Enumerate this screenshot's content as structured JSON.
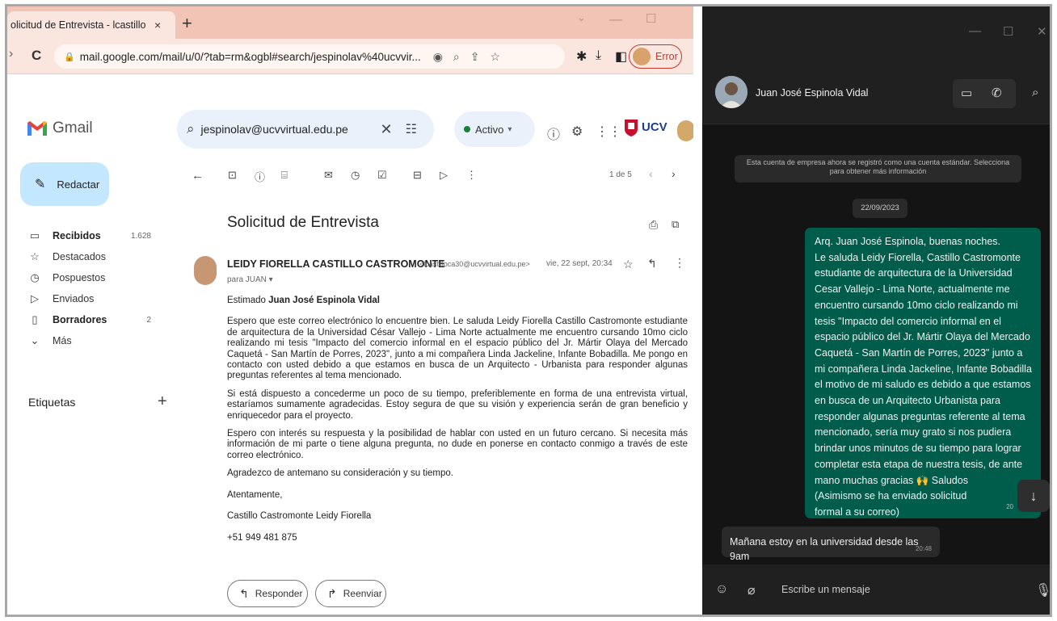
{
  "browser": {
    "tab_title": "olicitud de Entrevista - lcastillo",
    "tab_close": "×",
    "new_tab": "+",
    "url": "mail.google.com/mail/u/0/?tab=rm&ogbl#search/jespinolav%40ucvvir...",
    "profile_status": "Error"
  },
  "gmail": {
    "logo_text": "Gmail",
    "search_value": "jespinolav@ucvvirtual.edu.pe",
    "status_label": "Activo",
    "org_logo_text": "UCV",
    "compose_label": "Redactar",
    "nav": [
      {
        "label": "Recibidos",
        "count": "1.628",
        "bold": true,
        "icon": "inbox-icon"
      },
      {
        "label": "Destacados",
        "count": "",
        "bold": false,
        "icon": "star-icon"
      },
      {
        "label": "Pospuestos",
        "count": "",
        "bold": false,
        "icon": "clock-icon"
      },
      {
        "label": "Enviados",
        "count": "",
        "bold": false,
        "icon": "send-icon"
      },
      {
        "label": "Borradores",
        "count": "2",
        "bold": true,
        "icon": "draft-icon"
      },
      {
        "label": "Más",
        "count": "",
        "bold": false,
        "icon": "chevron-down-icon"
      }
    ],
    "labels_title": "Etiquetas",
    "labels_add": "+",
    "page_count": "1 de 5"
  },
  "email": {
    "subject": "Solicitud de Entrevista",
    "sender_name": "LEIDY FIORELLA CASTILLO CASTROMONTE",
    "sender_email": "<lcastilloca30@ucvvirtual.edu.pe>",
    "date": "vie, 22 sept, 20:34",
    "to": "para JUAN",
    "greeting_prefix": "Estimado",
    "greeting_name": "Juan José Espinola Vidal",
    "paragraphs": [
      "Espero que este correo electrónico lo encuentre bien. Le saluda Leidy Fiorella Castillo Castromonte estudiante de arquitectura de la Universidad César Vallejo - Lima Norte actualmente me encuentro cursando 10mo ciclo realizando mi tesis \"Impacto del comercio informal en el espacio público del Jr. Mártir Olaya del Mercado Caquetá - San Martín de Porres, 2023\", junto a mi compañera Linda Jackeline, Infante Bobadilla. Me pongo en contacto con usted debido a que estamos en busca de un Arquitecto - Urbanista para responder algunas preguntas referentes al tema mencionado.",
      "Si está dispuesto a concederme un poco de su tiempo, preferiblemente en forma de una entrevista virtual, estaríamos sumamente agradecidas. Estoy segura de que su visión y experiencia serán de gran beneficio y enriquecedor para el proyecto.",
      "Espero con interés su respuesta y la posibilidad de hablar con usted en un futuro cercano. Si necesita más información de mi parte o tiene alguna pregunta, no dude en ponerse en contacto conmigo a través de este correo electrónico.",
      "Agradezco de antemano su consideración y su tiempo."
    ],
    "closing": "Atentamente,",
    "signature_name": "Castillo Castromonte Leidy Fiorella",
    "signature_phone": "+51 949 481 875",
    "reply_label": "Responder",
    "forward_label": "Reenviar"
  },
  "whatsapp": {
    "contact_name": "Juan José Espinola Vidal",
    "system_message": "Esta cuenta de empresa ahora se registró como una cuenta estándar. Selecciona para obtener más información",
    "date_chip": "22/09/2023",
    "outgoing_text": "Arq. Juan José Espinola, buenas noches.\nLe saluda Leidy Fiorella, Castillo Castromonte estudiante de arquitectura de la Universidad Cesar Vallejo - Lima Norte, actualmente me encuentro cursando 10mo ciclo realizando mi tesis \"Impacto del comercio informal en el espacio público del Jr. Mártir Olaya del Mercado Caquetá - San Martín de Porres, 2023\" junto a mi compañera Linda Jackeline, Infante Bobadilla el motivo de mi saludo es debido a que estamos en busca de un Arquitecto Urbanista para responder algunas preguntas referente al tema mencionado, sería muy grato si nos pudiera brindar unos minutos de su tiempo para lograr completar esta etapa de nuestra tesis, de ante mano muchas gracias 🙌 Saludos\n(Asimismo se ha enviado solicitud\nformal a su correo)",
    "outgoing_time": "20",
    "incoming_text": "Mañana estoy en la universidad desde las 9am",
    "incoming_time": "20:48",
    "input_placeholder": "Escribe un mensaje"
  },
  "colors": {
    "gmail_compose": "#c2e7ff",
    "gmail_search": "#eaf1fb",
    "chrome_tabstrip": "#f1c4b6",
    "whatsapp_outgoing": "#005c4b",
    "whatsapp_bg": "#141414"
  }
}
